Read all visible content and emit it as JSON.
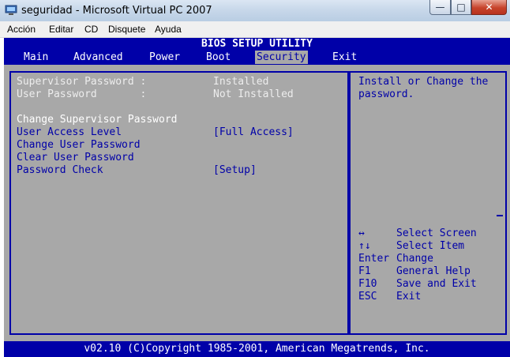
{
  "window": {
    "title": "seguridad - Microsoft Virtual PC 2007",
    "minimize_glyph": "—",
    "maximize_glyph": "□",
    "close_glyph": "✕"
  },
  "menubar": {
    "items": [
      "Acción",
      "Editar",
      "CD",
      "Disquete",
      "Ayuda"
    ]
  },
  "bios": {
    "title": "BIOS SETUP UTILITY",
    "tabs": [
      "Main",
      "Advanced",
      "Power",
      "Boot",
      "Security",
      "Exit"
    ],
    "active_tab": "Security",
    "status": [
      {
        "label": "Supervisor Password :",
        "value": "Installed"
      },
      {
        "label": "User Password       :",
        "value": "Not Installed"
      }
    ],
    "options": [
      {
        "label": "Change Supervisor Password",
        "value": ""
      },
      {
        "label": "User Access Level",
        "value": "[Full Access]"
      },
      {
        "label": "Change User Password",
        "value": ""
      },
      {
        "label": "Clear User Password",
        "value": ""
      },
      {
        "label": "Password Check",
        "value": "[Setup]"
      }
    ],
    "help_text": [
      "Install or Change the",
      "password."
    ],
    "keys": [
      {
        "key": "↔",
        "action": "Select Screen"
      },
      {
        "key": "↑↓",
        "action": "Select Item"
      },
      {
        "key": "Enter",
        "action": "Change"
      },
      {
        "key": "F1",
        "action": "General Help"
      },
      {
        "key": "F10",
        "action": "Save and Exit"
      },
      {
        "key": "ESC",
        "action": "Exit"
      }
    ],
    "copyright": "v02.10 (C)Copyright 1985-2001, American Megatrends, Inc."
  },
  "colors": {
    "bios_blue": "#0000a8",
    "bios_grey": "#a8a8a8",
    "highlight": "#ffffff"
  }
}
